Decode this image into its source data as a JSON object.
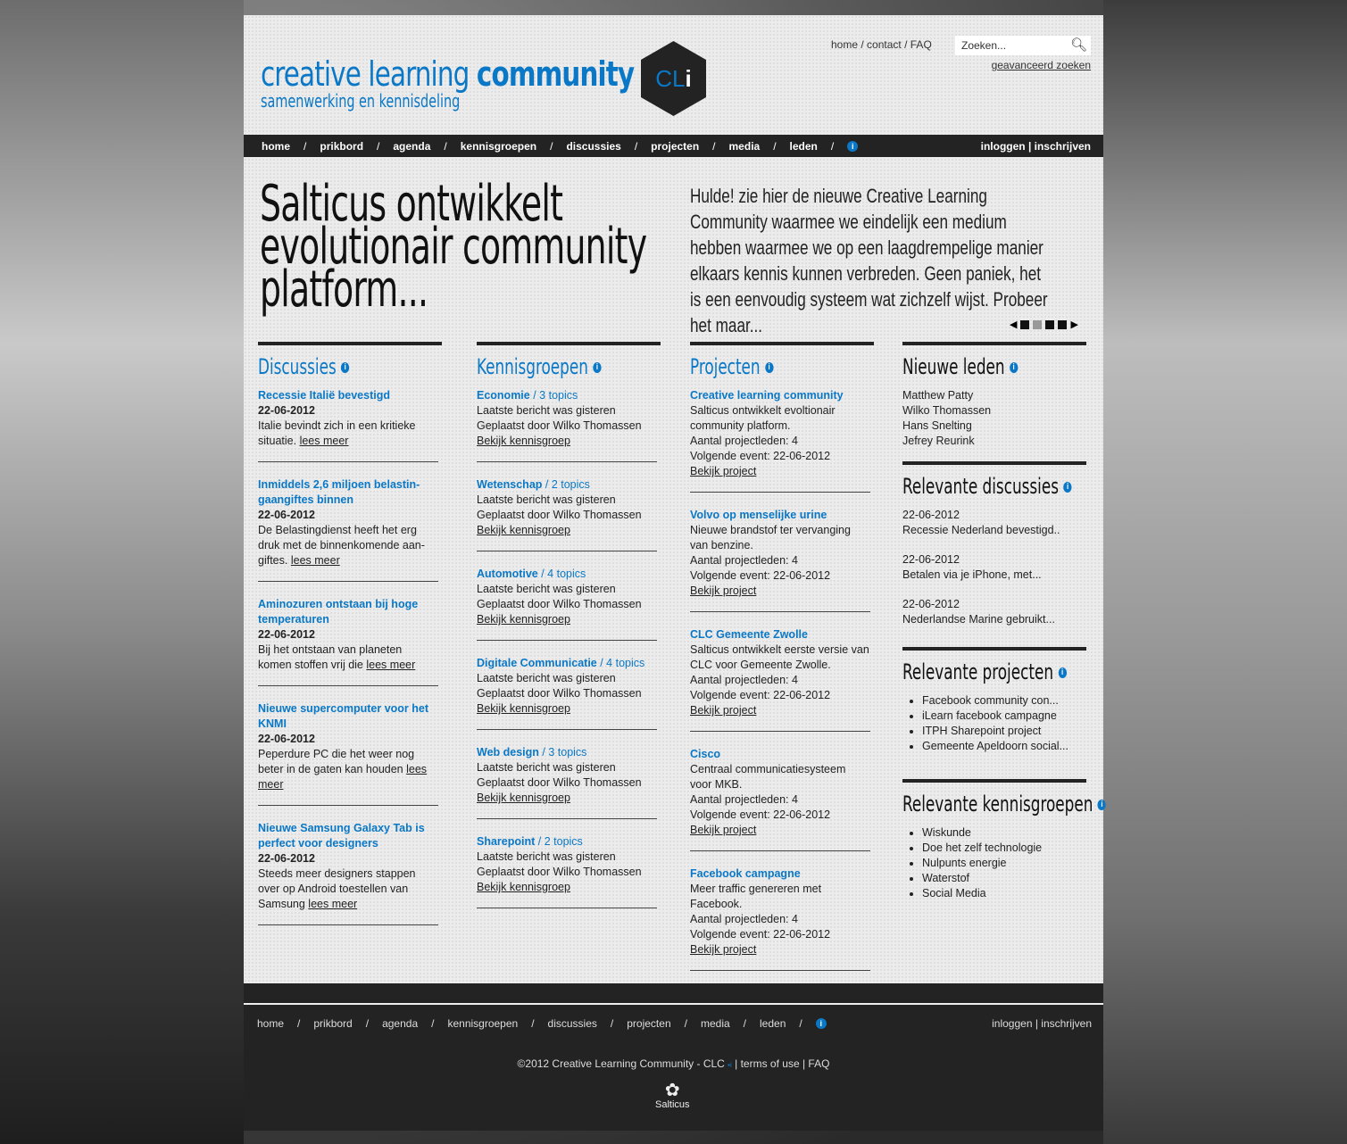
{
  "header": {
    "logo_light": "creative learning",
    "logo_bold": "community",
    "tagline": "samenwerking en kennisdeling",
    "badge_a": "CL",
    "badge_b": "i",
    "toplinks": [
      "home",
      "contact",
      "FAQ"
    ],
    "search_placeholder": "Zoeken...",
    "advanced": "geavanceerd zoeken"
  },
  "nav": {
    "items": [
      "home",
      "prikbord",
      "agenda",
      "kennisgroepen",
      "discussies",
      "projecten",
      "media",
      "leden"
    ],
    "login": "inloggen",
    "register": "inschrijven"
  },
  "hero": {
    "title": "Salticus ontwikkelt evolutionair community platform...",
    "intro": "Hulde! zie hier de nieuwe Creative Learning Community waarmee we eindelijk een medium hebben waarmee we op een laagdrempelige manier elkaars kennis kunnen verbreden. Geen paniek, het is een eenvoudig systeem wat zichzelf wijst. Probeer het maar..."
  },
  "discussies": {
    "title": "Discussies",
    "items": [
      {
        "title": "Recessie Italië bevestigd",
        "date": "22-06-2012",
        "text": "Italie bevindt zich in een kritieke situatie.",
        "more": "lees meer"
      },
      {
        "title": "Inmiddels 2,6 miljoen belastin-gaangiftes binnen",
        "date": "22-06-2012",
        "text": "De Belastingdienst heeft het erg druk met de binnenkomende aan-giftes.",
        "more": "lees meer"
      },
      {
        "title": "Aminozuren ontstaan bij hoge temperaturen",
        "date": "22-06-2012",
        "text": "Bij het ontstaan van planeten komen stoffen vrij die",
        "more": "lees meer"
      },
      {
        "title": "Nieuwe supercomputer voor het KNMI",
        "date": "22-06-2012",
        "text": "Peperdure PC die het weer nog beter in de gaten kan houden",
        "more": "lees meer"
      },
      {
        "title": "Nieuwe Samsung Galaxy Tab is perfect voor designers",
        "date": "22-06-2012",
        "text": "Steeds meer designers stappen over op Android toestellen van Samsung",
        "more": "lees meer"
      }
    ]
  },
  "kennisgroepen": {
    "title": "Kennisgroepen",
    "items": [
      {
        "name": "Economie",
        "topics": "/ 3 topics",
        "last": "Laatste bericht was gisteren",
        "by": "Geplaatst door Wilko Thomassen",
        "link": "Bekijk kennisgroep"
      },
      {
        "name": "Wetenschap",
        "topics": "/ 2 topics",
        "last": "Laatste bericht was gisteren",
        "by": "Geplaatst door Wilko Thomassen",
        "link": "Bekijk kennisgroep"
      },
      {
        "name": "Automotive",
        "topics": "/ 4 topics",
        "last": "Laatste bericht was gisteren",
        "by": "Geplaatst door Wilko Thomassen",
        "link": "Bekijk kennisgroep"
      },
      {
        "name": "Digitale Communicatie",
        "topics": "/ 4 topics",
        "last": "Laatste bericht was gisteren",
        "by": "Geplaatst door Wilko Thomassen",
        "link": "Bekijk kennisgroep"
      },
      {
        "name": "Web design",
        "topics": "/ 3 topics",
        "last": "Laatste bericht was gisteren",
        "by": "Geplaatst door Wilko Thomassen",
        "link": "Bekijk kennisgroep"
      },
      {
        "name": "Sharepoint",
        "topics": "/ 2 topics",
        "last": "Laatste bericht was gisteren",
        "by": "Geplaatst door Wilko Thomassen",
        "link": "Bekijk kennisgroep"
      }
    ]
  },
  "projecten": {
    "title": "Projecten",
    "items": [
      {
        "name": "Creative learning community",
        "desc": "Salticus ontwikkelt evoltionair community platform.",
        "members": "Aantal projectleden: 4",
        "event": "Volgende event: 22-06-2012",
        "link": "Bekijk project"
      },
      {
        "name": "Volvo op menselijke urine",
        "desc": "Nieuwe brandstof ter vervanging van benzine.",
        "members": "Aantal projectleden: 4",
        "event": "Volgende event: 22-06-2012",
        "link": "Bekijk project"
      },
      {
        "name": "CLC Gemeente Zwolle",
        "desc": "Salticus ontwikkelt eerste versie van CLC voor Gemeente Zwolle.",
        "members": "Aantal projectleden: 4",
        "event": "Volgende event: 22-06-2012",
        "link": "Bekijk project"
      },
      {
        "name": "Cisco",
        "desc": "Centraal communicatiesysteem voor MKB.",
        "members": "Aantal projectleden: 4",
        "event": "Volgende event: 22-06-2012",
        "link": "Bekijk project"
      },
      {
        "name": "Facebook campagne",
        "desc": "Meer traffic genereren met Facebook.",
        "members": "Aantal projectleden: 4",
        "event": "Volgende event: 22-06-2012",
        "link": "Bekijk project"
      }
    ]
  },
  "sidebar": {
    "leden_title": "Nieuwe leden",
    "leden": [
      "Matthew Patty",
      "Wilko Thomassen",
      "Hans Snelting",
      "Jefrey Reurink"
    ],
    "disc_title": "Relevante discussies",
    "disc": [
      {
        "date": "22-06-2012",
        "text": "Recessie Nederland bevestigd.."
      },
      {
        "date": "22-06-2012",
        "text": "Betalen via je iPhone, met..."
      },
      {
        "date": "22-06-2012",
        "text": "Nederlandse Marine gebruikt..."
      }
    ],
    "proj_title": "Relevante projecten",
    "proj": [
      "Facebook community con...",
      "iLearn facebook campagne",
      "ITPH Sharepoint project",
      "Gemeente Apeldoorn social..."
    ],
    "kg_title": "Relevante kennisgroepen",
    "kg": [
      "Wiskunde",
      "Doe het zelf technologie",
      "Nulpunts energie",
      "Waterstof",
      "Social Media"
    ]
  },
  "footer": {
    "copyright": "©2012 Creative Learning Community - CLC",
    "terms": "terms of use",
    "faq": "FAQ",
    "brand": "Salticus"
  }
}
